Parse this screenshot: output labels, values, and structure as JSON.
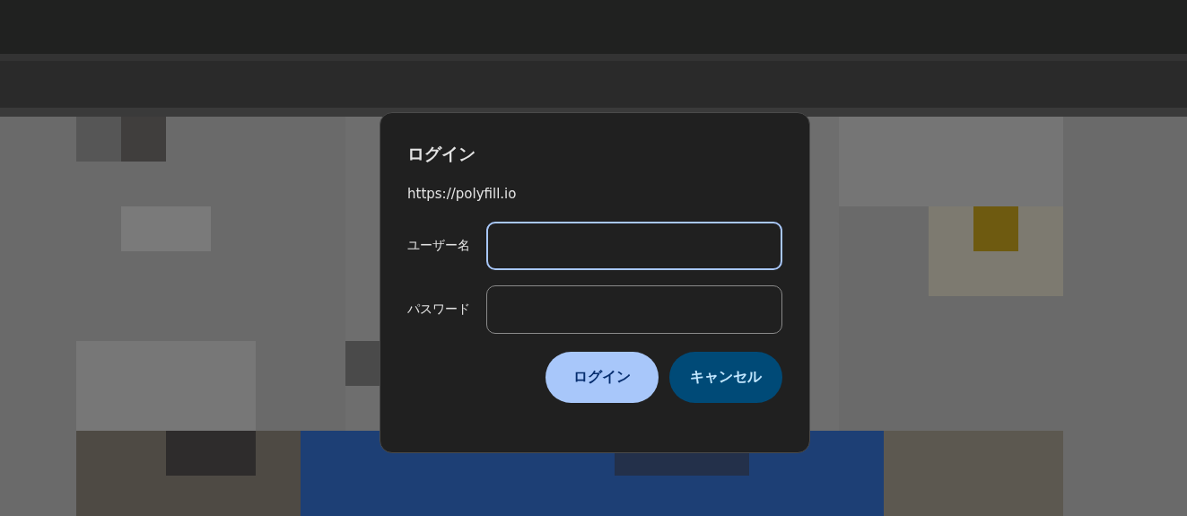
{
  "dialog": {
    "title": "ログイン",
    "origin": "https://polyfill.io",
    "fields": [
      {
        "label": "ユーザー名",
        "focused": true
      },
      {
        "label": "パスワード",
        "focused": false
      }
    ],
    "buttons": [
      {
        "label": "ログイン",
        "kind": "primary"
      },
      {
        "label": "キャンセル",
        "kind": "secondary"
      }
    ]
  }
}
